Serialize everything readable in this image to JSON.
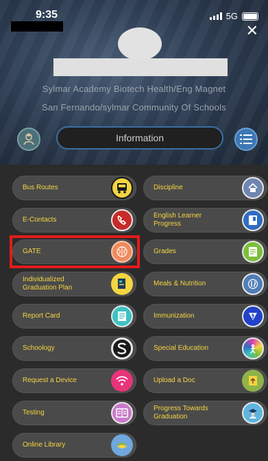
{
  "status_bar": {
    "time": "9:35",
    "network": "5G"
  },
  "header": {
    "school_line_1": "Sylmar Academy Biotech Health/Eng Magnet",
    "school_line_2": "San Fernando/sylmar Community Of Schools",
    "tab_label": "Information",
    "close_symbol": "✕"
  },
  "left_items": [
    {
      "label": "Bus Routes",
      "icon": "bus-icon",
      "color": "#f4d542"
    },
    {
      "label": "E-Contacts",
      "icon": "phone-icon",
      "color": "#c92a2a"
    },
    {
      "label": "GATE",
      "icon": "brain-icon",
      "color": "#f08a5d"
    },
    {
      "label": "Individualized\nGraduation Plan",
      "icon": "plan-icon",
      "color": "#f4d542"
    },
    {
      "label": "Report Card",
      "icon": "report-card-icon",
      "color": "#3ec2c2"
    },
    {
      "label": "Schoology",
      "icon": "schoology-icon",
      "color": "#1a1a1a"
    },
    {
      "label": "Request a Device",
      "icon": "wifi-icon",
      "color": "#e8347a"
    },
    {
      "label": "Testing",
      "icon": "testing-icon",
      "color": "#c97bc9"
    },
    {
      "label": "Online Library",
      "icon": "books-icon",
      "color": "#6ea8dc"
    }
  ],
  "right_items": [
    {
      "label": "Discipline",
      "icon": "school-house-icon",
      "color": "#6f86b0"
    },
    {
      "label": "English Learner\nProgress",
      "icon": "book-icon",
      "color": "#2f6cc4"
    },
    {
      "label": "Grades",
      "icon": "grades-icon",
      "color": "#7cbf3a"
    },
    {
      "label": "Meals & Nutrition",
      "icon": "utensils-icon",
      "color": "#4f7fb8"
    },
    {
      "label": "Immunization",
      "icon": "caduceus-icon",
      "color": "#2242c8"
    },
    {
      "label": "Special Education",
      "icon": "color-wheel-icon",
      "color": "#e33fae"
    },
    {
      "label": "Upload a Doc",
      "icon": "upload-doc-icon",
      "color": "#8fb34a"
    },
    {
      "label": "Progress Towards\nGraduation",
      "icon": "graduate-icon",
      "color": "#5fb4e0"
    }
  ]
}
